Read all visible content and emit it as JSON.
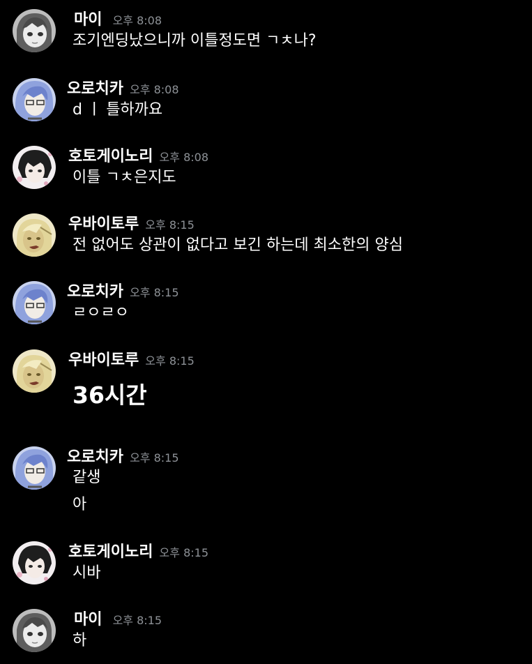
{
  "messages": [
    {
      "user": "마이",
      "time": "오후 8:08",
      "lines": [
        "조기엔딩났으니까 이틀정도면 ㄱㅊ나?"
      ]
    },
    {
      "user": "오로치카",
      "time": "오후 8:08",
      "lines": [
        "d ㅣ 틀하까요"
      ]
    },
    {
      "user": "호토게이노리",
      "time": "오후 8:08",
      "lines": [
        "이틀 ㄱㅊ은지도"
      ]
    },
    {
      "user": "우바이토루",
      "time": "오후 8:15",
      "lines": [
        "전 없어도 상관이 없다고 보긴 하는데 최소한의 양심"
      ]
    },
    {
      "user": "오로치카",
      "time": "오후 8:15",
      "lines": [
        "ㄹㅇㄹㅇ"
      ]
    },
    {
      "user": "우바이토루",
      "time": "오후 8:15",
      "lines": [
        "36시간"
      ]
    },
    {
      "user": "오로치카",
      "time": "오후 8:15",
      "lines": [
        "같생",
        "아"
      ]
    },
    {
      "user": "호토게이노리",
      "time": "오후 8:15",
      "lines": [
        "시바"
      ]
    },
    {
      "user": "마이",
      "time": "오후 8:15",
      "lines": [
        "하"
      ]
    }
  ],
  "colors": {
    "background": "#000000",
    "username": "#ffffff",
    "timestamp": "#8e9297",
    "message_text": "#ffffff"
  }
}
